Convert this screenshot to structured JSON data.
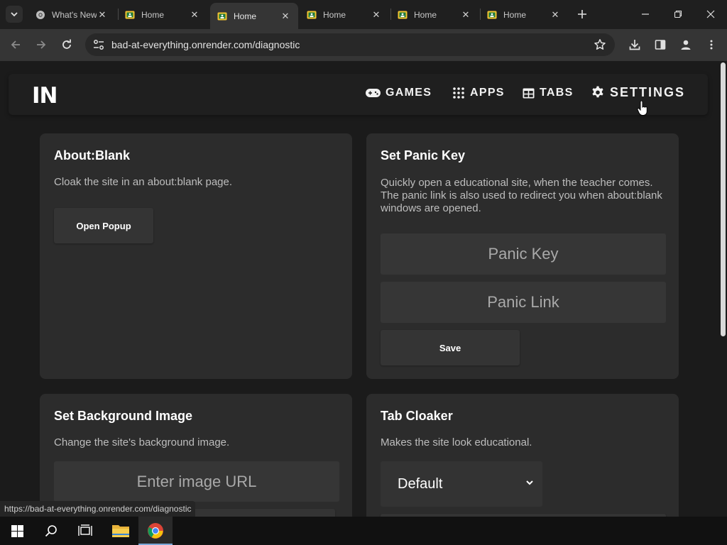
{
  "browser": {
    "tabs": [
      {
        "title": "What's New",
        "favicon": "chrome-icon",
        "active": false
      },
      {
        "title": "Home",
        "favicon": "classroom-icon",
        "active": false
      },
      {
        "title": "Home",
        "favicon": "classroom-icon",
        "active": true
      },
      {
        "title": "Home",
        "favicon": "classroom-icon",
        "active": false
      },
      {
        "title": "Home",
        "favicon": "classroom-icon",
        "active": false
      },
      {
        "title": "Home",
        "favicon": "classroom-icon",
        "active": false
      }
    ],
    "url": "bad-at-everything.onrender.com/diagnostic",
    "status_link": "https://bad-at-everything.onrender.com/diagnostic"
  },
  "site": {
    "logo": "IN",
    "nav": [
      {
        "label": "GAMES",
        "icon": "gamepad-icon"
      },
      {
        "label": "APPS",
        "icon": "grid-icon"
      },
      {
        "label": "TABS",
        "icon": "table-icon"
      },
      {
        "label": "SETTINGS",
        "icon": "gear-icon"
      }
    ]
  },
  "cards": {
    "about_blank": {
      "title": "About:Blank",
      "description": "Cloak the site in an about:blank page.",
      "button": "Open Popup"
    },
    "panic": {
      "title": "Set Panic Key",
      "description": "Quickly open a educational site, when the teacher comes. The panic link is also used to redirect you when about:blank windows are opened.",
      "key_placeholder": "Panic Key",
      "link_placeholder": "Panic Link",
      "button": "Save"
    },
    "background": {
      "title": "Set Background Image",
      "description": "Change the site's background image.",
      "placeholder": "Enter image URL"
    },
    "cloaker": {
      "title": "Tab Cloaker",
      "description": "Makes the site look educational.",
      "selected": "Default"
    }
  },
  "colors": {
    "page_bg": "#1b1b1b",
    "card_bg": "#2c2c2c",
    "nav_bg": "#1f1f1f",
    "accent_favicon": "#f4c430"
  }
}
